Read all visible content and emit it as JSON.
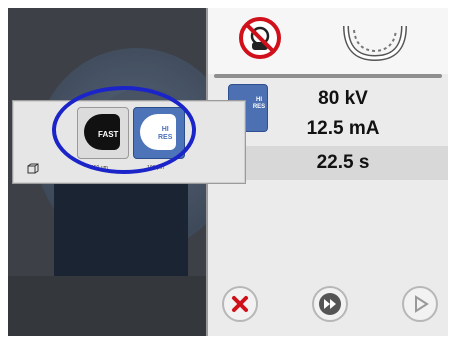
{
  "colors": {
    "accent_blue": "#4d73b8",
    "highlight_ring": "#1a24c8",
    "panel_dark": "#3d4147",
    "cancel_red": "#d0101a"
  },
  "icons": [
    "no-radiation-sign-icon",
    "dental-arch-icon",
    "hi-res-icon",
    "fast-mode-icon",
    "hi-res-mode-icon",
    "cube-icon",
    "cancel-icon",
    "fast-forward-icon",
    "play-icon"
  ],
  "exposure": {
    "voltage": "80 kV",
    "current": "12.5 mA",
    "time": "22.5 s"
  },
  "hires_small": {
    "line1": "HI",
    "line2": "RES"
  },
  "popup": {
    "fast_label": "FAST",
    "hires_line1": "HI",
    "hires_line2": "RES",
    "fast_resolution": "150 μm",
    "hires_resolution": "100 μm"
  }
}
